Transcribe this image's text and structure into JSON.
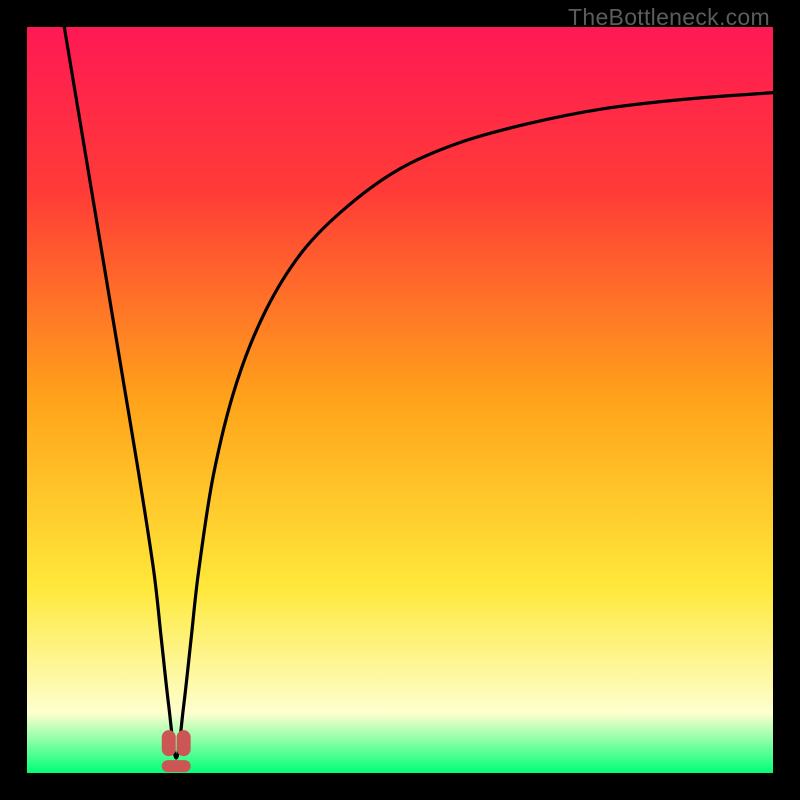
{
  "watermark": "TheBottleneck.com",
  "colors": {
    "frame": "#000000",
    "gradient_top": "#ff1954",
    "gradient_upper": "#ff3b37",
    "gradient_mid": "#ffa31a",
    "gradient_lower": "#ffe83a",
    "gradient_pale": "#fdffce",
    "gradient_bottom": "#00ff77",
    "curve": "#000000",
    "marker": "#cc5656"
  },
  "chart_data": {
    "type": "line",
    "title": "",
    "xlabel": "",
    "ylabel": "",
    "xlim": [
      0,
      100
    ],
    "ylim": [
      0,
      100
    ],
    "min_x": 20,
    "min_y": 2,
    "series": [
      {
        "name": "bottleneck-curve",
        "x": [
          5,
          7,
          9,
          11,
          13,
          15,
          17,
          18,
          19,
          20,
          21,
          22,
          23,
          25,
          28,
          32,
          37,
          43,
          50,
          58,
          67,
          77,
          88,
          100
        ],
        "y": [
          100,
          88,
          76,
          64,
          52,
          40,
          27,
          18,
          9,
          2,
          9,
          18,
          27,
          40,
          52,
          62,
          70,
          76,
          81,
          84.5,
          87,
          89,
          90.3,
          91.2
        ]
      }
    ],
    "markers": [
      {
        "name": "min-marker-left",
        "x": 19.0,
        "y": 4
      },
      {
        "name": "min-marker-right",
        "x": 21.0,
        "y": 4
      }
    ]
  }
}
